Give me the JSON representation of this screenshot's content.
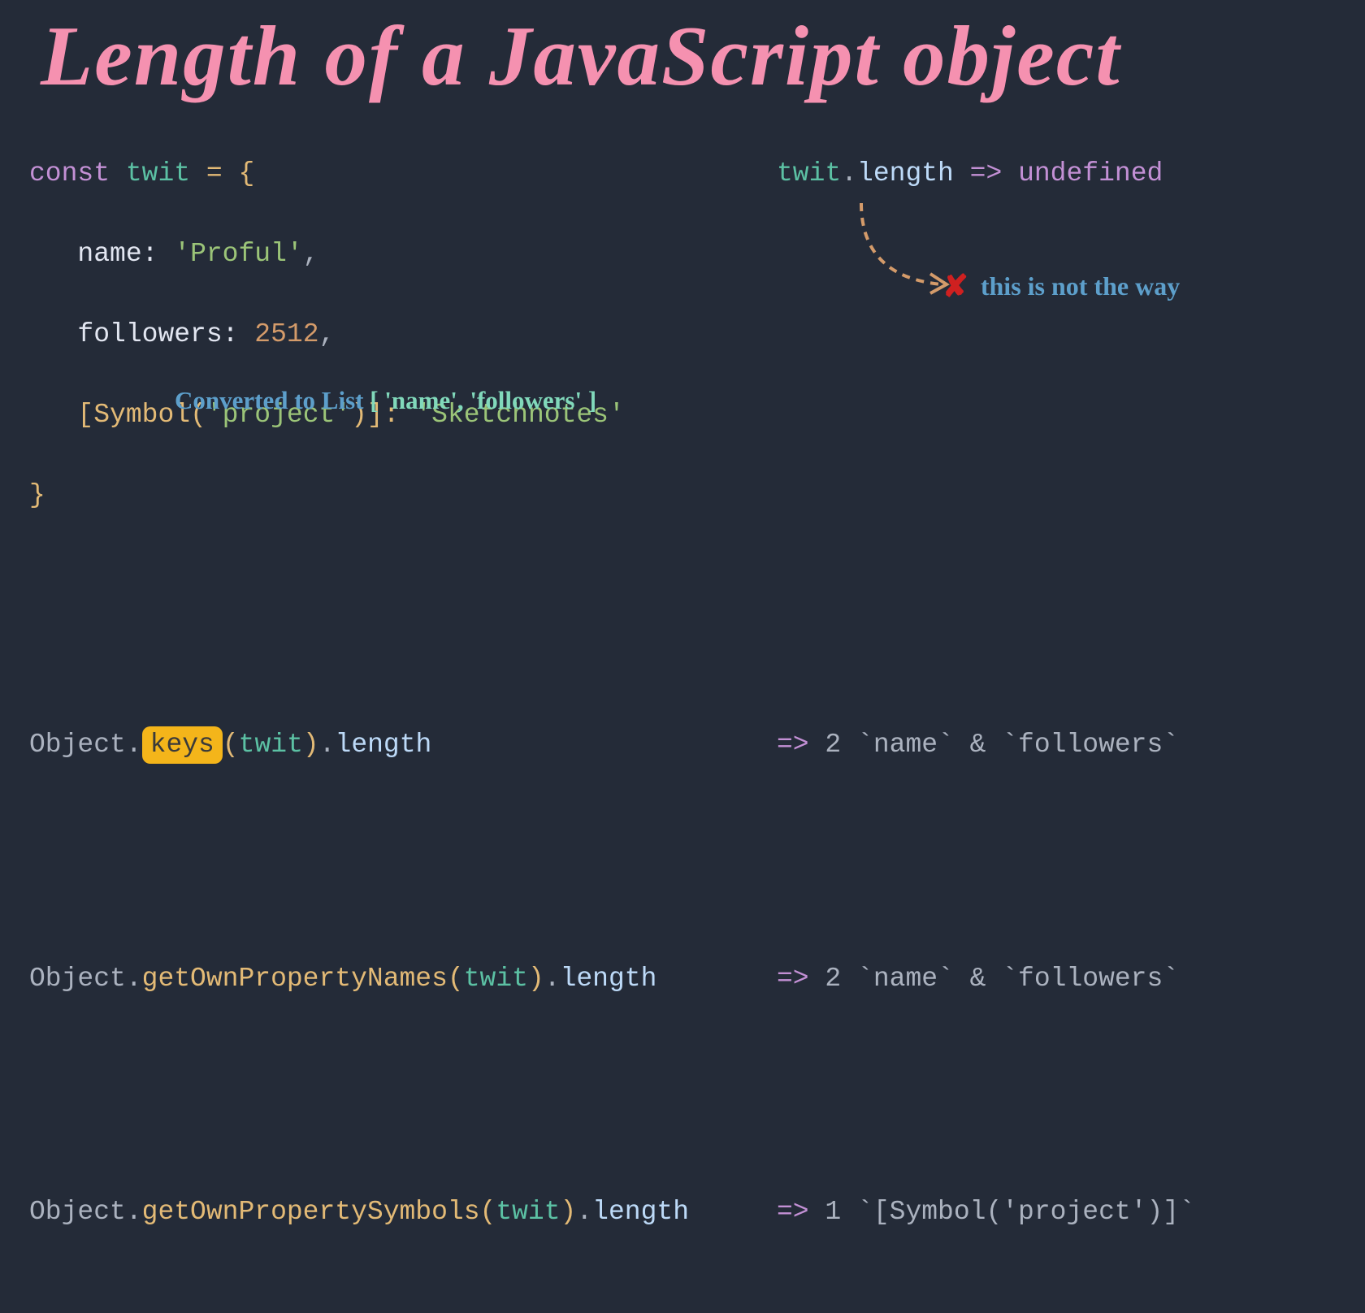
{
  "title": "Length of a JavaScript object",
  "code": {
    "const": "const",
    "varname": "twit",
    "eq": " = ",
    "openBrace": "{",
    "nameKey": "name:",
    "nameVal": "'Proful'",
    "comma": ",",
    "followersKey": "followers:",
    "followersVal": "2512",
    "symOpen": "[",
    "symClass": "Symbol",
    "symParenOpen": "(",
    "symStr": "'project'",
    "symParenClose": ")",
    "symClose": "]:",
    "symVal": "'Sketchnotes'",
    "closeBrace": "}"
  },
  "right1": {
    "var": "twit",
    "dot": ".",
    "len": "length",
    "arrow": " => ",
    "undef": "undefined"
  },
  "lines": {
    "obj": "Object",
    "dot": ".",
    "keys": "keys",
    "getPN": "getOwnPropertyNames",
    "getPS": "getOwnPropertySymbols",
    "open": "(",
    "twit": "twit",
    "close": ")",
    "len": "length",
    "arrow": "=> ",
    "r1": "2 `name` & `followers`",
    "r2": "2 `name` & `followers`",
    "r3": "1 `[Symbol('project')]`"
  },
  "annotations": {
    "converted": "Converted to List ",
    "list": "[ 'name', 'followers' ]",
    "notway": "this is not the way"
  }
}
